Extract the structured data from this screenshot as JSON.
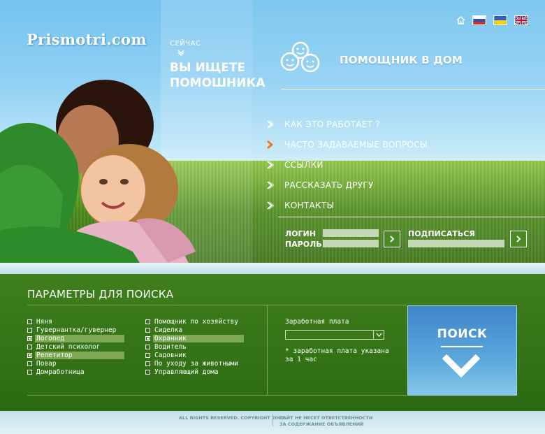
{
  "brand": {
    "logo_text": "Prismotri.com"
  },
  "hero": {
    "now_label": "СЕЙЧАС",
    "heading_line1": "ВЫ ИЩЕТЕ",
    "heading_line2": "ПОМОШНИКА",
    "tagline": "ПОМОЩНИК В ДОМ"
  },
  "language_bar": {
    "icons": [
      "home-icon",
      "flag-ru-icon",
      "flag-ua-icon",
      "flag-uk-icon"
    ]
  },
  "nav": {
    "items": [
      {
        "label": "КАК ЭТО РАБОТАЕТ ?"
      },
      {
        "label": "ЧАСТО ЗАДАВАЕМЫЕ ВОПРОСЫ",
        "active": true
      },
      {
        "label": "ССЫЛКИ"
      },
      {
        "label": "РАССКАЗАТЬ ДРУГУ"
      },
      {
        "label": "КОНТАКТЫ"
      }
    ],
    "accent_color": "#ff6a00"
  },
  "login": {
    "login_label": "ЛОГИН",
    "password_label": "ПАРОЛЬ",
    "subscribe_label": "ПОДПИСАТЬСЯ",
    "login_value": "",
    "password_value": "",
    "subscribe_value": ""
  },
  "search": {
    "title": "ПАРАМЕТРЫ ДЛЯ ПОИСКА",
    "col1": [
      {
        "label": "Няня",
        "selected": false
      },
      {
        "label": "Гувернантка/гувернер",
        "selected": false
      },
      {
        "label": "Логопед",
        "selected": true
      },
      {
        "label": "Детский психолог",
        "selected": false
      },
      {
        "label": "Репетитор",
        "selected": true
      },
      {
        "label": "Повар",
        "selected": false
      },
      {
        "label": "Домработница",
        "selected": false
      }
    ],
    "col2": [
      {
        "label": "Помощник по хозяйству",
        "selected": false
      },
      {
        "label": "Сиделка",
        "selected": false
      },
      {
        "label": "Охранник",
        "selected": true
      },
      {
        "label": "Водитель",
        "selected": false
      },
      {
        "label": "Садовник",
        "selected": false
      },
      {
        "label": "По уходу за животными",
        "selected": false
      },
      {
        "label": "Управляющий дома",
        "selected": false
      }
    ],
    "salary_label": "Заработная плата",
    "salary_value": "",
    "salary_note": "* заработная плата указана за 1 час",
    "button_label": "ПОИСК"
  },
  "footer": {
    "copyright": "ALL RIGHTS RESERVED. COPYRIGHT 2005.",
    "disclaimer_line1": "САЙТ НЕ НЕСЕТ ОТВЕТСТВЕННОСТИ",
    "disclaimer_line2": "ЗА СОДЕРЖАНИЕ ОБЪЯВЛЕНИЙ"
  }
}
